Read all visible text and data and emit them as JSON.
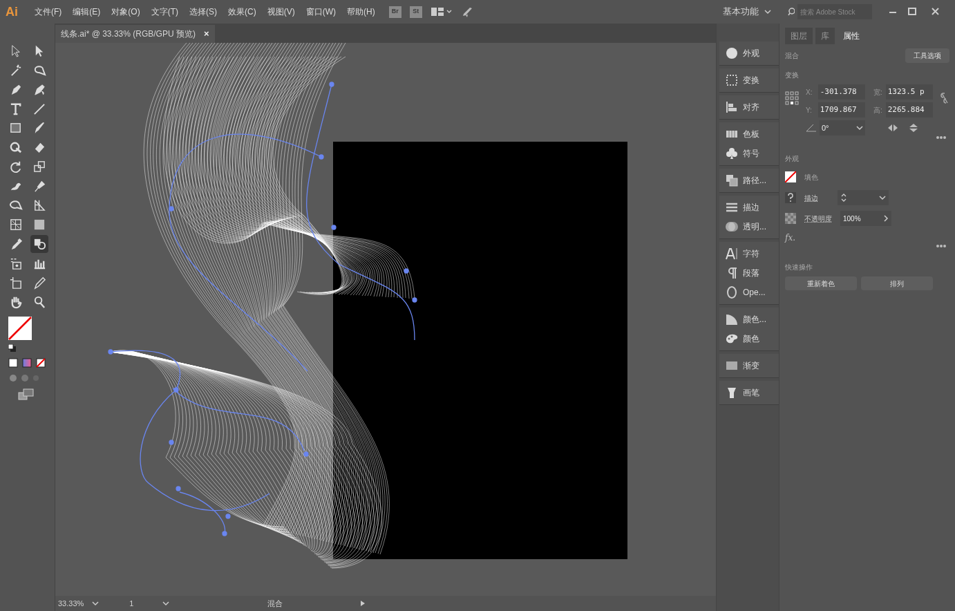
{
  "app_logo": "Ai",
  "menu": [
    "文件(F)",
    "编辑(E)",
    "对象(O)",
    "文字(T)",
    "选择(S)",
    "效果(C)",
    "视图(V)",
    "窗口(W)",
    "帮助(H)"
  ],
  "bridge_buttons": [
    "Br",
    "St"
  ],
  "workspace": "基本功能",
  "search": {
    "placeholder": "搜索 Adobe Stock"
  },
  "document_tab": {
    "title": "线条.ai* @ 33.33% (RGB/GPU 预览)",
    "close": "×"
  },
  "tools": [
    {
      "selected": false
    },
    {
      "selected": false
    },
    {
      "selected": false
    },
    {
      "selected": false
    },
    {
      "selected": false
    },
    {
      "selected": false
    },
    {
      "selected": false
    },
    {
      "selected": false
    },
    {
      "selected": false
    },
    {
      "selected": false
    },
    {
      "selected": false
    },
    {
      "selected": false
    },
    {
      "selected": false
    },
    {
      "selected": false
    },
    {
      "selected": false
    },
    {
      "selected": false
    },
    {
      "selected": false
    },
    {
      "selected": false
    },
    {
      "selected": false
    },
    {
      "selected": false
    },
    {
      "selected": false
    },
    {
      "selected": true
    },
    {
      "selected": false
    },
    {
      "selected": false
    },
    {
      "selected": false
    },
    {
      "selected": false
    },
    {
      "selected": false
    },
    {
      "selected": false
    }
  ],
  "dock": [
    [
      {
        "label": "外观"
      }
    ],
    [
      {
        "label": "变换"
      }
    ],
    [
      {
        "label": "对齐"
      }
    ],
    [
      {
        "label": "色板"
      },
      {
        "label": "符号"
      }
    ],
    [
      {
        "label": "路径..."
      }
    ],
    [
      {
        "label": "描边"
      },
      {
        "label": "透明..."
      }
    ],
    [
      {
        "label": "字符"
      },
      {
        "label": "段落"
      },
      {
        "label": "Ope..."
      }
    ],
    [
      {
        "label": "颜色..."
      },
      {
        "label": "颜色"
      }
    ],
    [
      {
        "label": "渐变"
      }
    ],
    [
      {
        "label": "画笔"
      }
    ]
  ],
  "properties": {
    "tabs": [
      {
        "label": "图层",
        "selected": false
      },
      {
        "label": "库",
        "selected": false
      },
      {
        "label": "属性",
        "selected": true
      }
    ],
    "blend_title": "混合",
    "tool_options": "工具选项",
    "transform_title": "变换",
    "fields": [
      {
        "label": "X:",
        "value": "-301.378"
      },
      {
        "label": "宽:",
        "value": "1323.5 p"
      },
      {
        "label": "Y:",
        "value": "1709.867"
      },
      {
        "label": "高:",
        "value": "2265.884"
      }
    ],
    "angle": "0°",
    "appearance_title": "外观",
    "fill_label": "填色",
    "stroke_label": "描边",
    "opacity_label": "不透明度",
    "opacity_value": "100%",
    "fx": "fx.",
    "quick_title": "快速操作",
    "quick_buttons": [
      "重新着色",
      "排列"
    ]
  },
  "status": {
    "zoom": "33.33%",
    "page": "1",
    "tool": "混合"
  }
}
